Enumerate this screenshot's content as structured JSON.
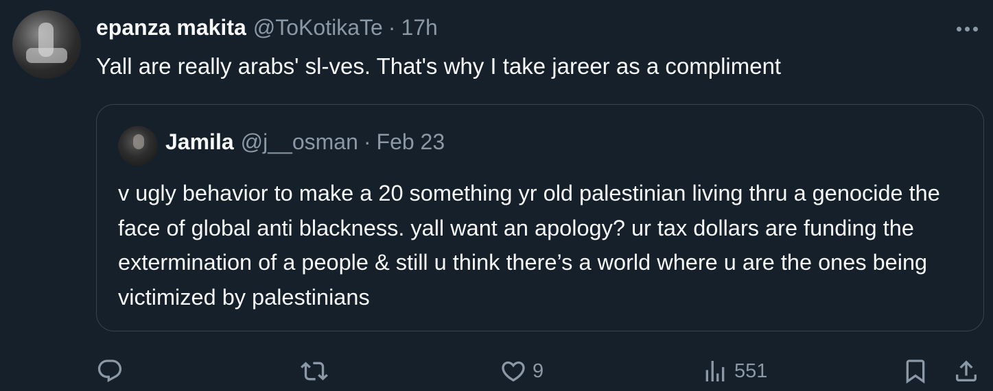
{
  "tweet": {
    "author_name": "epanza makita",
    "author_handle": "@ToKotikaTe",
    "separator": "·",
    "timestamp": "17h",
    "text": "Yall are really arabs' sl-ves. That's why I take jareer as a compliment"
  },
  "quoted": {
    "author_name": "Jamila",
    "author_handle": "@j__osman",
    "separator": "·",
    "timestamp": "Feb 23",
    "text": "v ugly behavior to make a 20 something yr old palestinian living thru a genocide the face of global anti blackness. yall want an apology? ur tax dollars are funding the extermination of a people & still u think there’s a world where u are the ones being victimized by palestinians"
  },
  "actions": {
    "reply_count": "",
    "retweet_count": "",
    "like_count": "9",
    "views_count": "551"
  },
  "icons": {
    "more": "more-horizontal-icon",
    "reply": "reply-icon",
    "retweet": "retweet-icon",
    "like": "heart-icon",
    "views": "views-icon",
    "bookmark": "bookmark-icon",
    "share": "share-icon"
  },
  "colors": {
    "background": "#15202b",
    "text_primary": "#f7f9f9",
    "text_secondary": "#8b98a5",
    "border": "#38444d"
  }
}
